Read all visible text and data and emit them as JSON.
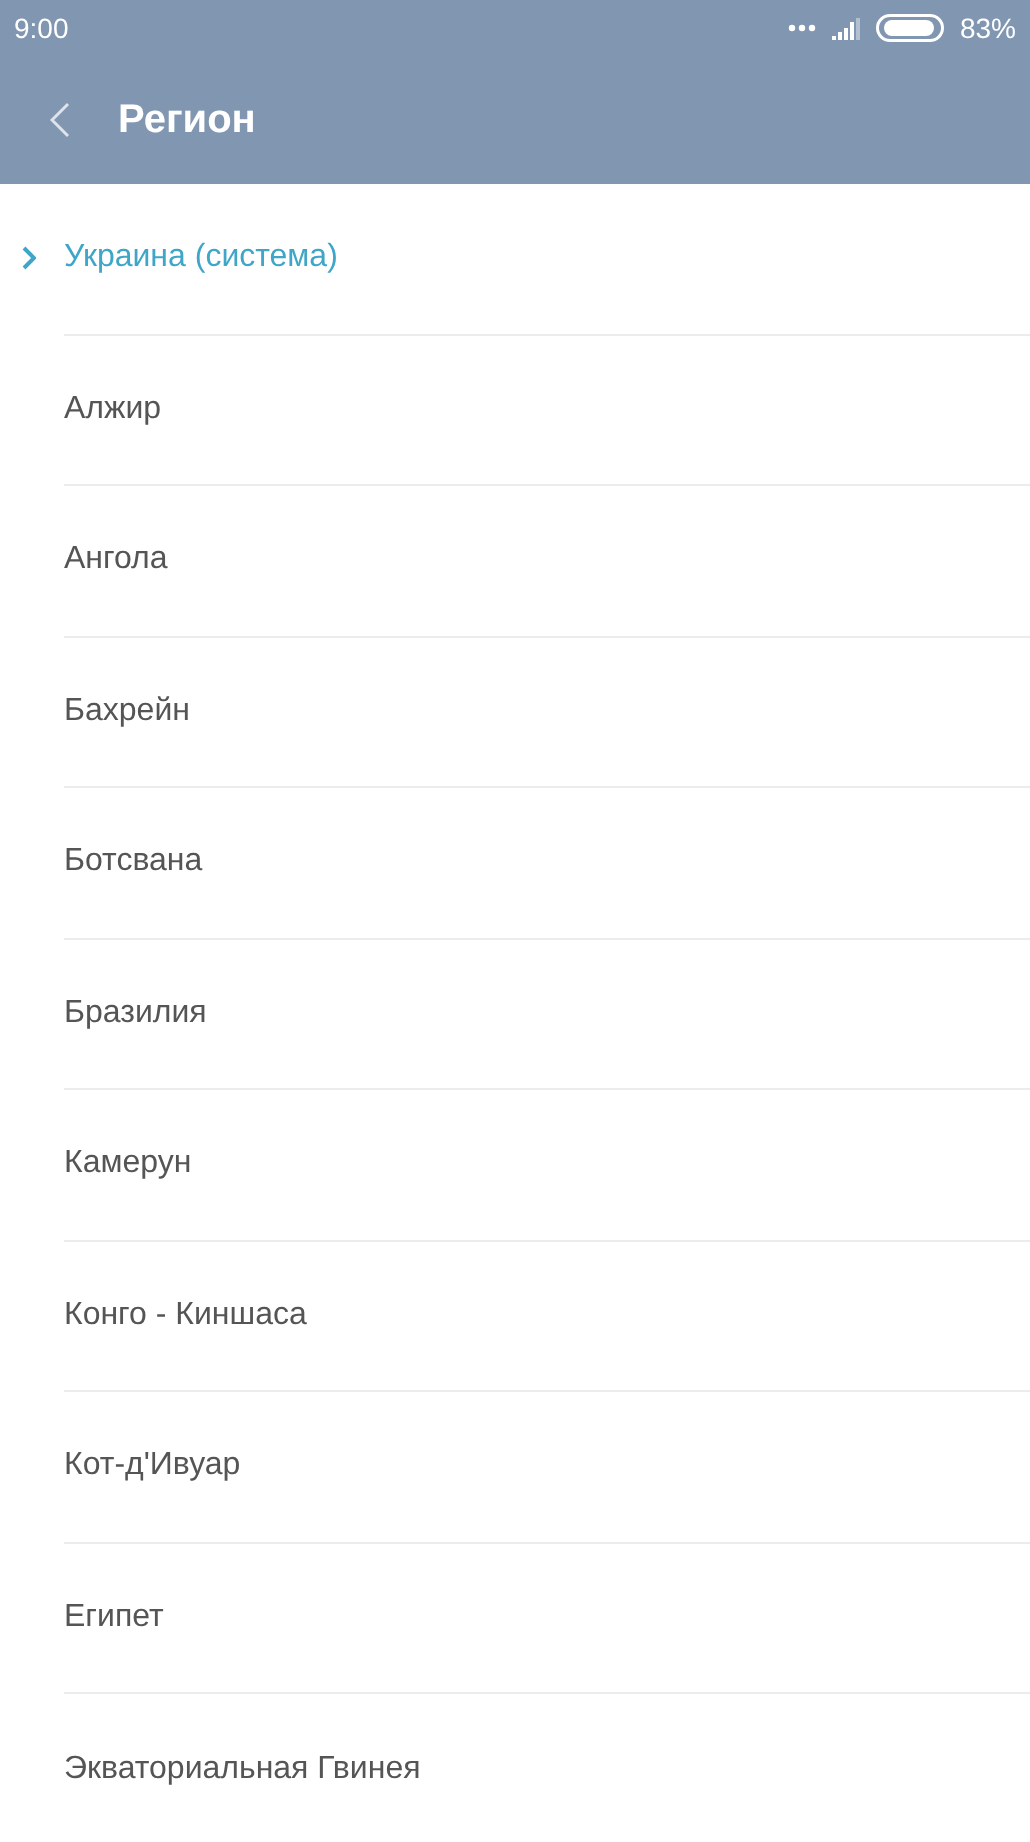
{
  "status_bar": {
    "time": "9:00",
    "battery": "83%"
  },
  "header": {
    "title": "Регион"
  },
  "regions": [
    {
      "label": "Украина (система)",
      "selected": true
    },
    {
      "label": "Алжир",
      "selected": false
    },
    {
      "label": "Ангола",
      "selected": false
    },
    {
      "label": "Бахрейн",
      "selected": false
    },
    {
      "label": "Ботсвана",
      "selected": false
    },
    {
      "label": "Бразилия",
      "selected": false
    },
    {
      "label": "Камерун",
      "selected": false
    },
    {
      "label": "Конго - Киншаса",
      "selected": false
    },
    {
      "label": "Кот-д'Ивуар",
      "selected": false
    },
    {
      "label": "Египет",
      "selected": false
    },
    {
      "label": "Экваториальная Гвинея",
      "selected": false
    }
  ]
}
